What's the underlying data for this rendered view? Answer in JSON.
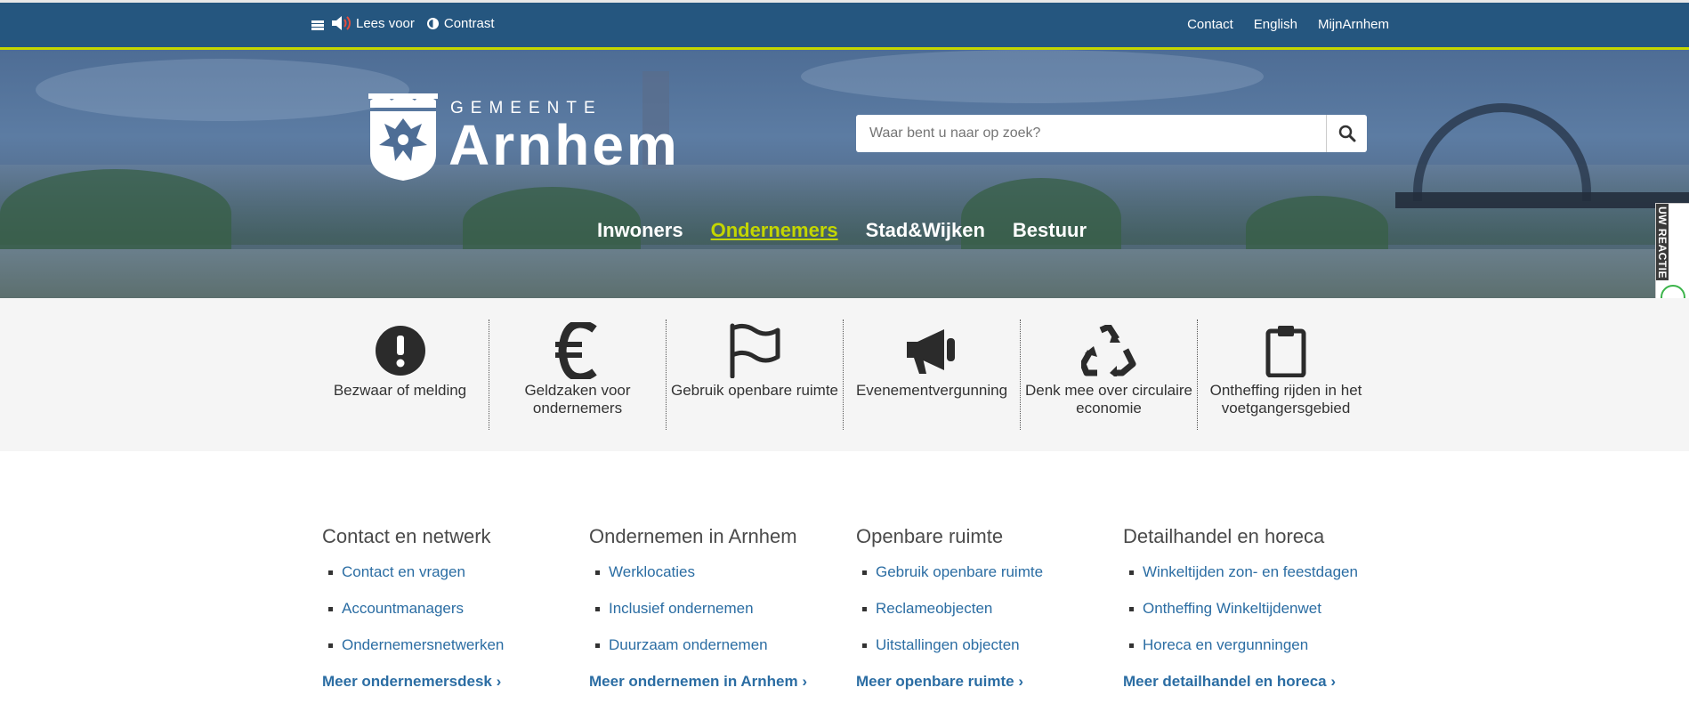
{
  "utility": {
    "read_aloud": "Lees voor",
    "contrast": "Contrast",
    "links": [
      "Contact",
      "English",
      "MijnArnhem"
    ]
  },
  "logo": {
    "top": "GEMEENTE",
    "name": "Arnhem"
  },
  "search": {
    "placeholder": "Waar bent u naar op zoek?"
  },
  "nav": {
    "items": [
      "Inwoners",
      "Ondernemers",
      "Stad&Wijken",
      "Bestuur"
    ],
    "active": "Ondernemers"
  },
  "feedback": {
    "label": "UW REACTIE",
    "colors": [
      "#3cb44b",
      "#f58220",
      "#e6397a"
    ]
  },
  "tasks": [
    {
      "label": "Bezwaar of melding",
      "icon": "exclamation-circle-icon"
    },
    {
      "label": "Geldzaken voor ondernemers",
      "icon": "euro-icon"
    },
    {
      "label": "Gebruik openbare ruimte",
      "icon": "flag-icon"
    },
    {
      "label": "Evenementvergunning",
      "icon": "megaphone-icon"
    },
    {
      "label": "Denk mee over circulaire economie",
      "icon": "recycle-icon"
    },
    {
      "label": "Ontheffing rijden in het voetgangersgebied",
      "icon": "clipboard-icon"
    }
  ],
  "columns": [
    {
      "title": "Contact en netwerk",
      "links": [
        "Contact en vragen",
        "Accountmanagers",
        "Ondernemersnetwerken"
      ],
      "more": "Meer ondernemersdesk"
    },
    {
      "title": "Ondernemen in Arnhem",
      "links": [
        "Werklocaties",
        "Inclusief ondernemen",
        "Duurzaam ondernemen"
      ],
      "more": "Meer ondernemen in Arnhem"
    },
    {
      "title": "Openbare ruimte",
      "links": [
        "Gebruik openbare ruimte",
        "Reclameobjecten",
        "Uitstallingen objecten"
      ],
      "more": "Meer openbare ruimte"
    },
    {
      "title": "Detailhandel en horeca",
      "links": [
        "Winkeltijden zon- en feestdagen",
        "Ontheffing Winkeltijdenwet",
        "Horeca en vergunningen"
      ],
      "more": "Meer detailhandel en horeca"
    }
  ],
  "colors": {
    "topbar": "#25567f",
    "accent": "#c4d600",
    "link": "#2b6da3"
  }
}
